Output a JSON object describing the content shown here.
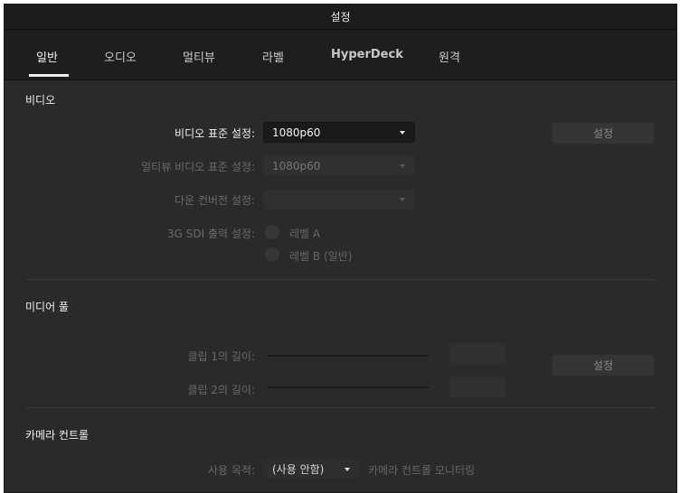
{
  "window": {
    "title": "설정"
  },
  "tabs": [
    {
      "label": "일반"
    },
    {
      "label": "오디오"
    },
    {
      "label": "멀티뷰"
    },
    {
      "label": "라벨"
    },
    {
      "label": "HyperDeck"
    },
    {
      "label": "원격"
    }
  ],
  "video": {
    "section_title": "비디오",
    "standard_label": "비디오 표준 설정:",
    "standard_value": "1080p60",
    "multiview_label": "멀티뷰 비디오 표준 설정:",
    "multiview_value": "1080p60",
    "downconvert_label": "다운 컨버전 설정:",
    "downconvert_value": "",
    "sdi_label": "3G SDI 출력 설정:",
    "sdi_option_a": "레벨 A",
    "sdi_option_b": "레벨 B (일반)",
    "set_button": "설정"
  },
  "media_pool": {
    "section_title": "미디어 풀",
    "clip1_label": "클립 1의 길이:",
    "clip2_label": "클립 2의 길이:",
    "set_button": "설정"
  },
  "camera_control": {
    "section_title": "카메라 컨트롤",
    "usage_label": "사용 목적:",
    "usage_value": "(사용 안함)",
    "monitoring_label": "카메라 컨트롤 모니터링"
  }
}
